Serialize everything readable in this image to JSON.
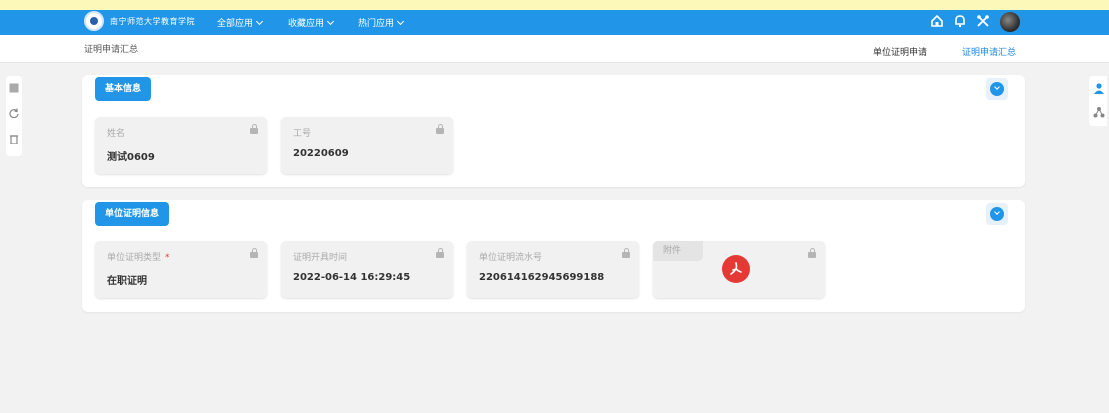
{
  "header": {
    "logo_text": "南宁师范大学教育学院",
    "nav": [
      "全部应用",
      "收藏应用",
      "热门应用"
    ],
    "icons": [
      "home-icon",
      "bell-icon",
      "tools-icon",
      "avatar"
    ]
  },
  "subbar": {
    "breadcrumb": "证明申请汇总",
    "tabs": [
      {
        "label": "单位证明申请",
        "active": false
      },
      {
        "label": "证明申请汇总",
        "active": true
      }
    ]
  },
  "sections": {
    "basic": {
      "title": "基本信息",
      "fields": [
        {
          "label": "姓名",
          "value": "测试0609"
        },
        {
          "label": "工号",
          "value": "20220609"
        }
      ]
    },
    "cert": {
      "title": "单位证明信息",
      "fields": [
        {
          "label": "单位证明类型",
          "required": "*",
          "value": "在职证明"
        },
        {
          "label": "证明开具时间",
          "value": "2022-06-14 16:29:45"
        },
        {
          "label": "单位证明流水号",
          "value": "220614162945699188"
        },
        {
          "label": "附件",
          "value": ""
        }
      ]
    }
  },
  "colors": {
    "primary": "#2196e9",
    "pdf": "#e53935",
    "active_tab": "#1e88e5"
  }
}
